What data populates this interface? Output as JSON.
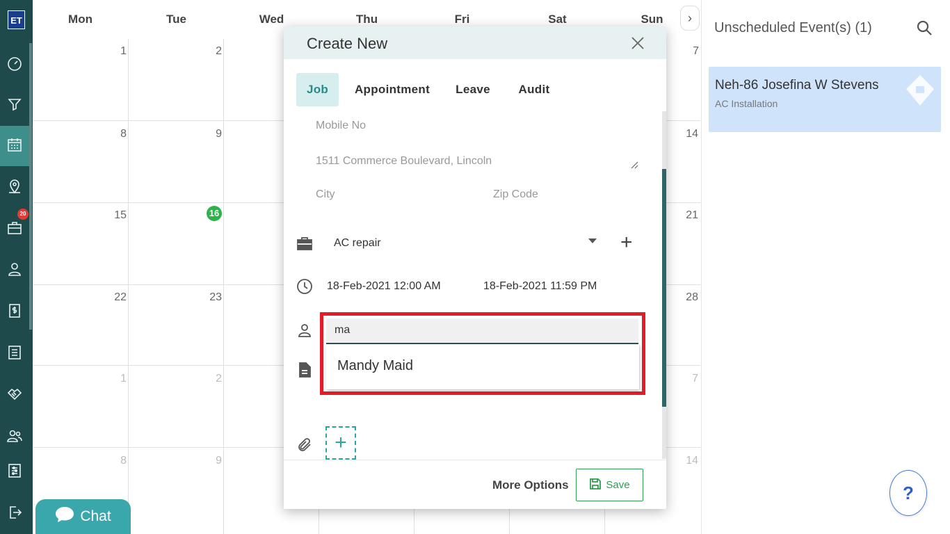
{
  "app": {
    "logo_text": "ET",
    "jobs_badge": "20"
  },
  "calendar": {
    "weekdays": [
      "Mon",
      "Tue",
      "Wed",
      "Thu",
      "Fri",
      "Sat",
      "Sun"
    ],
    "rows": [
      {
        "mon": "1",
        "tue": "2",
        "sun": "7"
      },
      {
        "mon": "8",
        "tue": "9",
        "sun": "14"
      },
      {
        "mon": "15",
        "tue": "16",
        "sun": "21"
      },
      {
        "mon": "22",
        "tue": "23",
        "sun": "28"
      },
      {
        "mon": "1",
        "tue": "2",
        "sun": "7"
      },
      {
        "mon": "8",
        "tue": "9",
        "sun": "14"
      }
    ],
    "today": "16"
  },
  "chat": {
    "label": "Chat"
  },
  "right_panel": {
    "title": "Unscheduled Event(s) (1)",
    "event": {
      "title": "Neh-86 Josefina W Stevens",
      "subtitle": "AC Installation"
    },
    "help_label": "?"
  },
  "modal": {
    "title": "Create New",
    "tabs": [
      "Job",
      "Appointment",
      "Leave",
      "Audit"
    ],
    "active_tab": "Job",
    "mobile_placeholder": "Mobile No",
    "address_value": "1511  Commerce Boulevard, Lincoln",
    "city_placeholder": "City",
    "zip_placeholder": "Zip Code",
    "job_type": "AC repair",
    "start_datetime": "18-Feb-2021 12:00 AM",
    "end_datetime": "18-Feb-2021 11:59 PM",
    "assignee_query": "ma",
    "assignee_suggestion": "Mandy Maid",
    "attach_add": "+",
    "more_options": "More Options",
    "save_label": "Save"
  }
}
